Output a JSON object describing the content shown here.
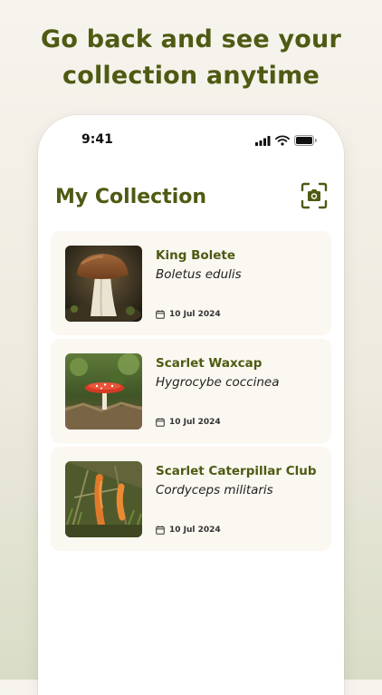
{
  "headline": {
    "line1": "Go back and see your",
    "line2": "collection anytime"
  },
  "status_bar": {
    "time": "9:41",
    "icons": [
      "signal-icon",
      "wifi-icon",
      "battery-icon"
    ]
  },
  "screen": {
    "title": "My Collection",
    "camera_icon": "camera-icon"
  },
  "collection": [
    {
      "name": "King Bolete",
      "latin": "Boletus edulis",
      "date": "10 Jul 2024"
    },
    {
      "name": "Scarlet Waxcap",
      "latin": "Hygrocybe coccinea",
      "date": "10 Jul 2024"
    },
    {
      "name": "Scarlet Caterpillar Club",
      "latin": "Cordyceps militaris",
      "date": "10 Jul 2024"
    }
  ],
  "colors": {
    "accent": "#4f5a12",
    "card_bg": "#fbf7f1",
    "page_bg": "#f7f4ee"
  }
}
